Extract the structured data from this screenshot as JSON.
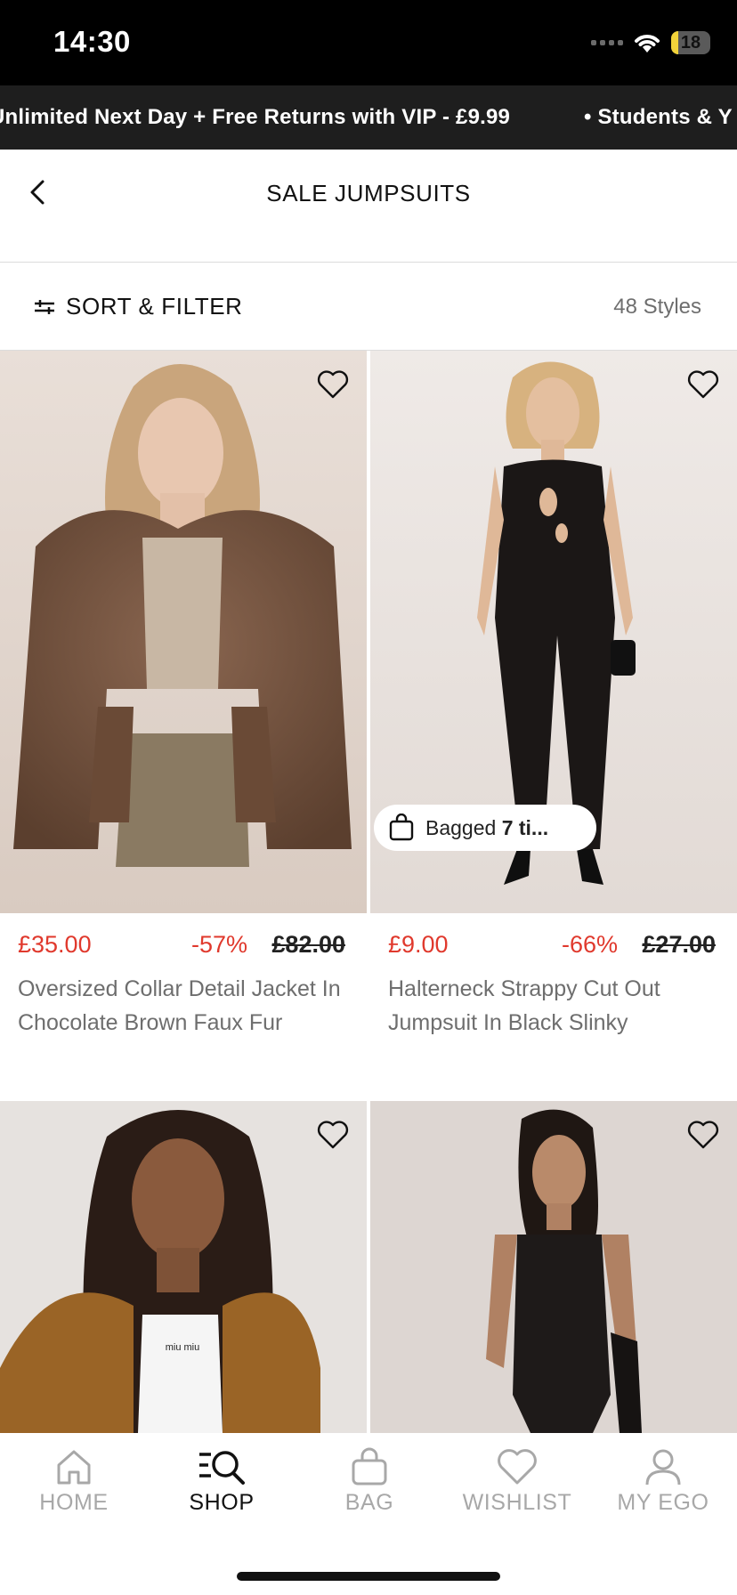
{
  "status_bar": {
    "time": "14:30",
    "battery": "18",
    "battery_level": 0.18
  },
  "promo": {
    "items": [
      "Unlimited Next Day + Free Returns with VIP - £9.99",
      "• Students & Y"
    ]
  },
  "header": {
    "title": "SALE JUMPSUITS",
    "back_icon": "chevron-left-icon"
  },
  "filter": {
    "label": "SORT & FILTER",
    "icon": "sliders-icon",
    "count": "48 Styles"
  },
  "products": [
    {
      "sale_price": "£35.00",
      "discount": "-57%",
      "original_price": "£82.00",
      "name": "Oversized Collar Detail Jacket In Chocolate Brown Faux Fur",
      "image": "model in brown faux fur jacket"
    },
    {
      "sale_price": "£9.00",
      "discount": "-66%",
      "original_price": "£27.00",
      "name": "Halterneck Strappy Cut Out Jumpsuit In Black Slinky",
      "badge": {
        "prefix": "Bagged ",
        "bold": "7 ti..."
      },
      "image": "model in black halterneck jumpsuit"
    },
    {
      "image": "model in tan faux fur coat"
    },
    {
      "image": "model in black wrap playsuit"
    }
  ],
  "bottom_nav": [
    {
      "label": "HOME",
      "icon": "home-icon",
      "active": false
    },
    {
      "label": "SHOP",
      "icon": "search-shop-icon",
      "active": true
    },
    {
      "label": "BAG",
      "icon": "bag-icon",
      "active": false
    },
    {
      "label": "WISHLIST",
      "icon": "heart-icon",
      "active": false
    },
    {
      "label": "MY EGO",
      "icon": "user-icon",
      "active": false
    }
  ],
  "colors": {
    "sale_red": "#e0392d",
    "promo_bg": "#1e1e1e",
    "battery_yellow": "#f2d33a"
  }
}
